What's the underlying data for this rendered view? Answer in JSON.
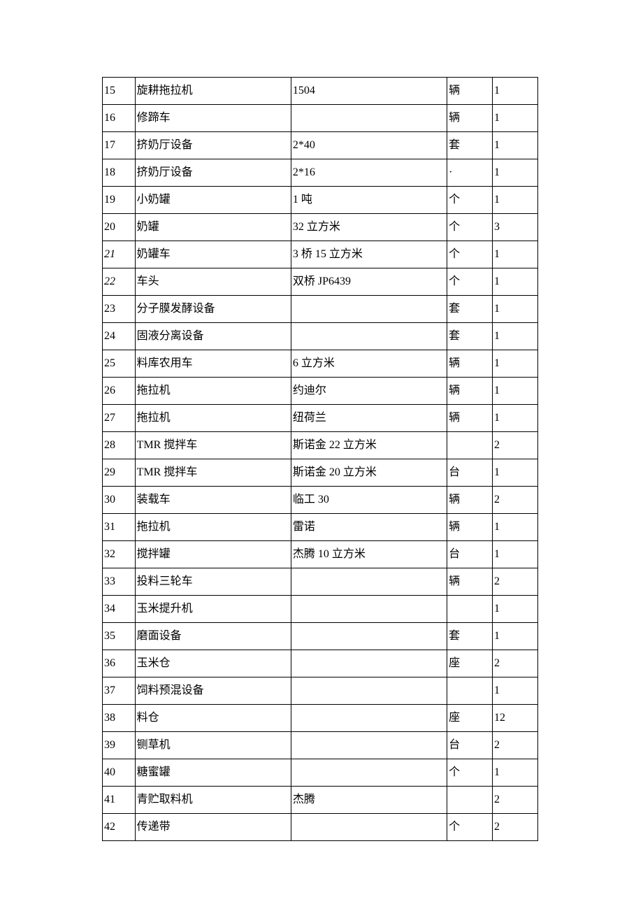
{
  "rows": [
    {
      "idx": "15",
      "name": "旋耕拖拉机",
      "spec": "1504",
      "unit": "辆",
      "qty": "1"
    },
    {
      "idx": "16",
      "name": "修蹄车",
      "spec": "",
      "unit": "辆",
      "qty": "1"
    },
    {
      "idx": "17",
      "name": "挤奶厅设备",
      "spec": "2*40",
      "unit": "套",
      "qty": "1"
    },
    {
      "idx": "18",
      "name": "挤奶厅设备",
      "spec": "2*16",
      "unit": "·",
      "qty": "1"
    },
    {
      "idx": "19",
      "name": "小奶罐",
      "spec": "1 吨",
      "unit": "个",
      "qty": "1"
    },
    {
      "idx": "20",
      "name": "奶罐",
      "spec": "32 立方米",
      "unit": "个",
      "qty": "3"
    },
    {
      "idx": "21",
      "name": "奶罐车",
      "spec": "3 桥 15 立方米",
      "unit": "个",
      "qty": "1",
      "italic": true
    },
    {
      "idx": "22",
      "name": "车头",
      "spec": "双桥 JP6439",
      "unit": "个",
      "qty": "1",
      "italic": true
    },
    {
      "idx": "23",
      "name": "分子膜发酵设备",
      "spec": "",
      "unit": "套",
      "qty": "1"
    },
    {
      "idx": "24",
      "name": "固液分离设备",
      "spec": "",
      "unit": "套",
      "qty": "1"
    },
    {
      "idx": "25",
      "name": "料库农用车",
      "spec": "6 立方米",
      "unit": "辆",
      "qty": "1"
    },
    {
      "idx": "26",
      "name": "拖拉机",
      "spec": "约迪尔",
      "unit": "辆",
      "qty": "1"
    },
    {
      "idx": "27",
      "name": "拖拉机",
      "spec": "纽荷兰",
      "unit": "辆",
      "qty": "1"
    },
    {
      "idx": "28",
      "name": "TMR 搅拌车",
      "spec": "斯诺金 22 立方米",
      "unit": "",
      "qty": "2"
    },
    {
      "idx": "29",
      "name": "TMR 搅拌车",
      "spec": "斯诺金 20 立方米",
      "unit": "台",
      "qty": "1"
    },
    {
      "idx": "30",
      "name": "装载车",
      "spec": "临工 30",
      "unit": "辆",
      "qty": "2"
    },
    {
      "idx": "31",
      "name": "拖拉机",
      "spec": "雷诺",
      "unit": "辆",
      "qty": "1"
    },
    {
      "idx": "32",
      "name": "搅拌罐",
      "spec": "杰腾 10 立方米",
      "unit": "台",
      "qty": "1"
    },
    {
      "idx": "33",
      "name": "投料三轮车",
      "spec": "",
      "unit": "辆",
      "qty": "2"
    },
    {
      "idx": "34",
      "name": "玉米提升机",
      "spec": "",
      "unit": "",
      "qty": "1"
    },
    {
      "idx": "35",
      "name": "磨面设备",
      "spec": "",
      "unit": "套",
      "qty": "1"
    },
    {
      "idx": "36",
      "name": "玉米仓",
      "spec": "",
      "unit": "座",
      "qty": "2"
    },
    {
      "idx": "37",
      "name": "饲料预混设备",
      "spec": "",
      "unit": "",
      "qty": "1"
    },
    {
      "idx": "38",
      "name": "料仓",
      "spec": "",
      "unit": "座",
      "qty": "12"
    },
    {
      "idx": "39",
      "name": "铡草机",
      "spec": "",
      "unit": "台",
      "qty": "2"
    },
    {
      "idx": "40",
      "name": "糖蜜罐",
      "spec": "",
      "unit": "个",
      "qty": "1"
    },
    {
      "idx": "41",
      "name": "青贮取料机",
      "spec": "杰腾",
      "unit": "",
      "qty": "2"
    },
    {
      "idx": "42",
      "name": "传递带",
      "spec": "",
      "unit": "个",
      "qty": "2"
    }
  ]
}
